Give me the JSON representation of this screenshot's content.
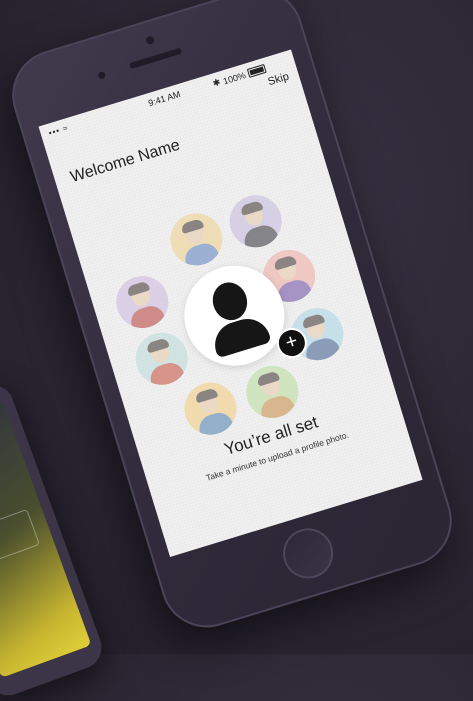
{
  "status_bar": {
    "signal": "▪▪▪ ≈",
    "time": "9:41 AM",
    "bluetooth": "✱",
    "battery_percent": "100%"
  },
  "nav": {
    "skip_label": "Skip"
  },
  "greeting": "Welcome Name",
  "avatars": [
    {
      "name": "avatar-1",
      "bg": "#cdb7e0",
      "shirt": "#b73a3a"
    },
    {
      "name": "avatar-2",
      "bg": "#f0d08a",
      "shirt": "#5a7fbf"
    },
    {
      "name": "avatar-3",
      "bg": "#c4b8de",
      "shirt": "#2f2f38"
    },
    {
      "name": "avatar-4",
      "bg": "#b9dbd8",
      "shirt": "#c24a3a"
    },
    {
      "name": "avatar-5",
      "bg": "#f1a8a0",
      "shirt": "#6b4aa0"
    },
    {
      "name": "avatar-6",
      "bg": "#f2cb7a",
      "shirt": "#4a7fb0"
    },
    {
      "name": "avatar-7",
      "bg": "#b7dd9a",
      "shirt": "#c88a40"
    },
    {
      "name": "avatar-8",
      "bg": "#a8d3e4",
      "shirt": "#3a5a8a"
    }
  ],
  "main": {
    "title": "You’re all set",
    "subtitle": "Take a minute to upload a profile photo.",
    "add_icon": "+"
  }
}
